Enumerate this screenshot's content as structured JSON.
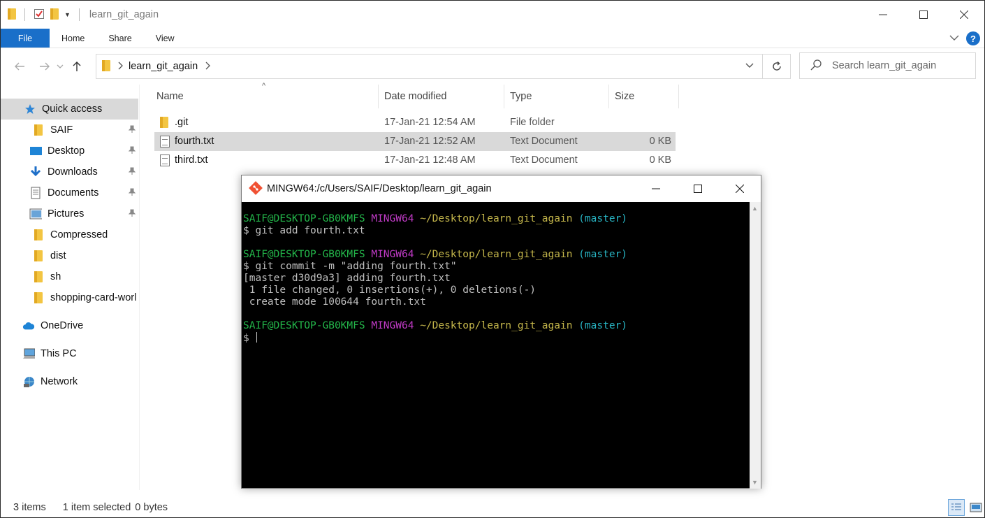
{
  "window": {
    "title": "learn_git_again",
    "colors": {
      "accent": "#1a6fc9",
      "selection": "#d9d9d9"
    }
  },
  "ribbon": {
    "tabs": [
      "File",
      "Home",
      "Share",
      "View"
    ]
  },
  "address": {
    "crumb": "learn_git_again",
    "search_placeholder": "Search learn_git_again"
  },
  "sidebar": {
    "items": [
      {
        "label": "Quick access",
        "icon": "star-icon",
        "pinned": false,
        "active": true
      },
      {
        "label": "SAIF",
        "icon": "folder-icon",
        "pinned": true
      },
      {
        "label": "Desktop",
        "icon": "desktop-icon",
        "pinned": true
      },
      {
        "label": "Downloads",
        "icon": "download-icon",
        "pinned": true
      },
      {
        "label": "Documents",
        "icon": "documents-icon",
        "pinned": true
      },
      {
        "label": "Pictures",
        "icon": "pictures-icon",
        "pinned": true
      },
      {
        "label": "Compressed",
        "icon": "folder-icon",
        "pinned": false
      },
      {
        "label": "dist",
        "icon": "folder-icon",
        "pinned": false
      },
      {
        "label": "sh",
        "icon": "folder-icon",
        "pinned": false
      },
      {
        "label": "shopping-card-worl",
        "icon": "folder-icon",
        "pinned": false
      },
      {
        "label": "OneDrive",
        "icon": "cloud-icon",
        "pinned": false
      },
      {
        "label": "This PC",
        "icon": "computer-icon",
        "pinned": false
      },
      {
        "label": "Network",
        "icon": "network-icon",
        "pinned": false
      }
    ]
  },
  "files": {
    "columns": [
      "Name",
      "Date modified",
      "Type",
      "Size"
    ],
    "rows": [
      {
        "name": ".git",
        "date": "17-Jan-21 12:54 AM",
        "type": "File folder",
        "size": "",
        "icon": "folder-icon"
      },
      {
        "name": "fourth.txt",
        "date": "17-Jan-21 12:52 AM",
        "type": "Text Document",
        "size": "0 KB",
        "icon": "text-file-icon",
        "selected": true
      },
      {
        "name": "third.txt",
        "date": "17-Jan-21 12:48 AM",
        "type": "Text Document",
        "size": "0 KB",
        "icon": "text-file-icon"
      }
    ]
  },
  "status": {
    "count": "3 items",
    "selection": "1 item selected",
    "size": "0 bytes"
  },
  "terminal": {
    "title": "MINGW64:/c/Users/SAIF/Desktop/learn_git_again",
    "user_host": "SAIF@DESKTOP-GB0KMFS",
    "env": "MINGW64",
    "path": "~/Desktop/learn_git_again",
    "branch": "(master)",
    "prompt": "$",
    "commands": [
      "git add fourth.txt",
      "git commit -m \"adding fourth.txt\""
    ],
    "output": [
      "[master d30d9a3] adding fourth.txt",
      " 1 file changed, 0 insertions(+), 0 deletions(-)",
      " create mode 100644 fourth.txt"
    ],
    "colors": {
      "user": "#23b74a",
      "env": "#c23bc8",
      "path": "#c4b64b",
      "branch": "#28b5c4"
    }
  }
}
